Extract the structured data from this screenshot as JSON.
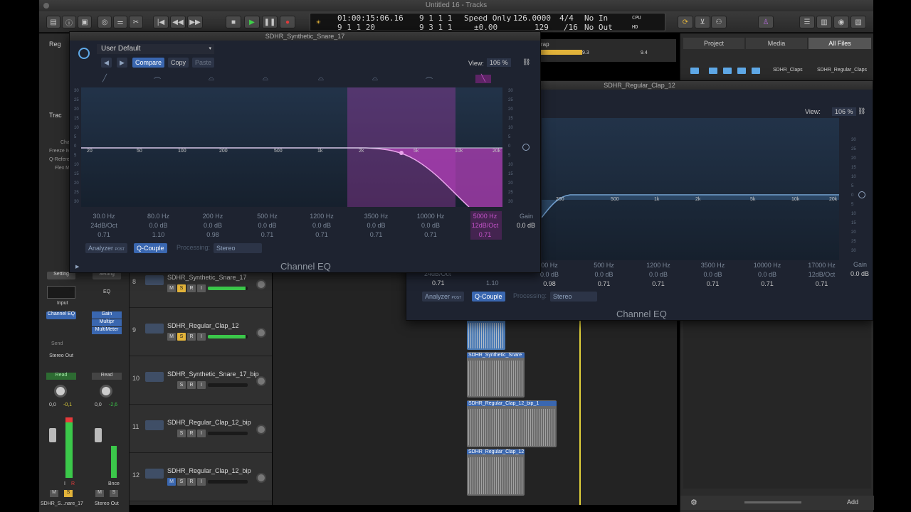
{
  "window": {
    "title": "Untitled 16 - Tracks"
  },
  "lcd": {
    "position_time": "01:00:15:06.16",
    "bars_1": "9  1  1  1",
    "bars_2": "9  1  1  20",
    "bars_3": "9  3  1  1",
    "mode": "Speed Only",
    "speed": "126.0000",
    "percent": "±0.00",
    "sig_top": "4/4",
    "sig_bottom": "/16",
    "tempo": "129",
    "in_label": "No In",
    "out_label": "No Out",
    "cpu": "CPU",
    "hd": "HD"
  },
  "inspector": {
    "region_label": "Reg",
    "track_label": "Trac",
    "params": [
      "Cha",
      "Freeze M",
      "Q-Refere",
      "Flex M"
    ],
    "setting": "Setting",
    "eq": "EQ",
    "input": "Input",
    "plugin_1": "Channel EQ",
    "plugins_2": [
      "Gain",
      "Multipr",
      "MultiMeter"
    ],
    "send": "Send",
    "stereo_out": "Stereo Out",
    "read": "Read",
    "pan_left": "0,0",
    "peak_left": "-0,1",
    "pan_right": "0,0",
    "peak_right": "-2,6",
    "bnce": "Bnce",
    "strip_left_name": "SDHR_S...nare_17",
    "strip_right_name": "Stereo Out",
    "mute": "M",
    "solo": "S",
    "input_mon": "I",
    "rec": "R"
  },
  "tracks": [
    {
      "num": "8",
      "name": "SDHR_Synthetic_Snare_17"
    },
    {
      "num": "9",
      "name": "SDHR_Regular_Clap_12"
    },
    {
      "num": "10",
      "name": "SDHR_Synthetic_Snare_17_bip"
    },
    {
      "num": "11",
      "name": "SDHR_Regular_Clap_12_bip"
    },
    {
      "num": "12",
      "name": "SDHR_Regular_Clap_12_bip"
    }
  ],
  "track_buttons": {
    "m": "M",
    "s": "S",
    "r": "R",
    "i": "I"
  },
  "regions": [
    {
      "name": "SDHR_Synthetic_Snare"
    },
    {
      "name": "SDHR_Regular_Clap_12_bip_1"
    },
    {
      "name": "SDHR_Regular_Clap_12"
    }
  ],
  "ruler": {
    "mark1": "9.3",
    "mark2": "9.4",
    "menu": "rap"
  },
  "browser": {
    "tabs": [
      "Project",
      "Media",
      "All Files"
    ],
    "path_1": "SDHR_Claps",
    "path_2": "SDHR_Regular_Claps",
    "add": "Add"
  },
  "eq_main": {
    "title": "SDHR_Synthetic_Snare_17",
    "preset": "User Default",
    "compare": "Compare",
    "copy": "Copy",
    "paste": "Paste",
    "view_label": "View:",
    "view_value": "106 %",
    "freq_axis": [
      "20",
      "50",
      "100",
      "200",
      "500",
      "1k",
      "2k",
      "5k",
      "10k",
      "20k"
    ],
    "db_axis": [
      "30",
      "25",
      "20",
      "15",
      "10",
      "5",
      "0",
      "5",
      "10",
      "15",
      "20",
      "25",
      "30"
    ],
    "bands": [
      {
        "freq": "30.0 Hz",
        "gain": "24dB/Oct",
        "q": "0.71"
      },
      {
        "freq": "80.0 Hz",
        "gain": "0.0 dB",
        "q": "1.10"
      },
      {
        "freq": "200 Hz",
        "gain": "0.0 dB",
        "q": "0.98"
      },
      {
        "freq": "500 Hz",
        "gain": "0.0 dB",
        "q": "0.71"
      },
      {
        "freq": "1200 Hz",
        "gain": "0.0 dB",
        "q": "0.71"
      },
      {
        "freq": "3500 Hz",
        "gain": "0.0 dB",
        "q": "0.71"
      },
      {
        "freq": "10000 Hz",
        "gain": "0.0 dB",
        "q": "0.71"
      },
      {
        "freq": "5000 Hz",
        "gain": "12dB/Oct",
        "q": "0.71"
      }
    ],
    "gain_label": "Gain",
    "gain_value": "0.0 dB",
    "analyzer": "Analyzer",
    "post": "POST",
    "q_couple": "Q-Couple",
    "processing_label": "Processing:",
    "processing_value": "Stereo",
    "footer": "Channel EQ",
    "accent": "#b23fb8"
  },
  "eq_back": {
    "title": "SDHR_Regular_Clap_12",
    "view_label": "View:",
    "view_value": "106 %",
    "freq_axis": [
      "200",
      "500",
      "1k",
      "2k",
      "5k",
      "10k",
      "20k"
    ],
    "db_axis": [
      "30",
      "25",
      "20",
      "15",
      "10",
      "5",
      "0",
      "5",
      "10",
      "15",
      "20",
      "25",
      "30"
    ],
    "bands": [
      {
        "freq": "00 Hz",
        "gain": "0.0 dB",
        "q": "0.98"
      },
      {
        "freq": "500 Hz",
        "gain": "0.0 dB",
        "q": "0.71"
      },
      {
        "freq": "1200 Hz",
        "gain": "0.0 dB",
        "q": "0.71"
      },
      {
        "freq": "3500 Hz",
        "gain": "0.0 dB",
        "q": "0.71"
      },
      {
        "freq": "10000 Hz",
        "gain": "0.0 dB",
        "q": "0.71"
      },
      {
        "freq": "17000 Hz",
        "gain": "12dB/Oct",
        "q": "0.71"
      }
    ],
    "left_gain": "24dB/Oct",
    "left_q": "0.71",
    "left_q2": "1.10",
    "gain_label": "Gain",
    "gain_value": "0.0 dB",
    "analyzer": "Analyzer",
    "post": "POST",
    "q_couple": "Q-Couple",
    "processing_label": "Processing:",
    "processing_value": "Stereo",
    "footer": "Channel EQ",
    "accent": "#4a7fb5"
  }
}
